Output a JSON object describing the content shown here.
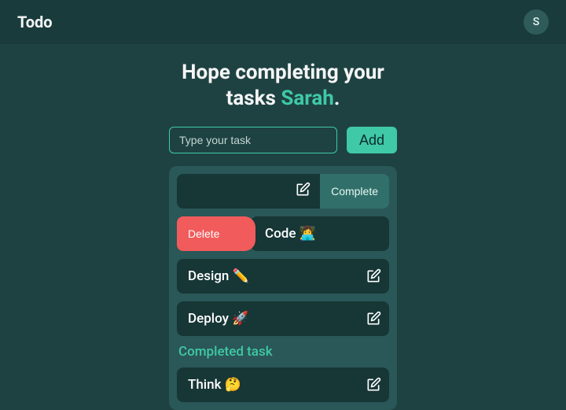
{
  "header": {
    "brand": "Todo",
    "avatar_initial": "S"
  },
  "hero": {
    "line1": "Hope completing your",
    "line2_prefix": "tasks ",
    "name": "Sarah",
    "line2_suffix": "."
  },
  "input": {
    "placeholder": "Type your task",
    "add_label": "Add"
  },
  "actions": {
    "complete_label": "Complete",
    "delete_label": "Delete"
  },
  "tasks": {
    "swiped_left_label": "",
    "swiped_right_label": "Code 👩‍💻",
    "items": [
      "Design ✏️",
      "Deploy 🚀"
    ]
  },
  "completed": {
    "title": "Completed task",
    "items": [
      "Think 🤔"
    ]
  }
}
